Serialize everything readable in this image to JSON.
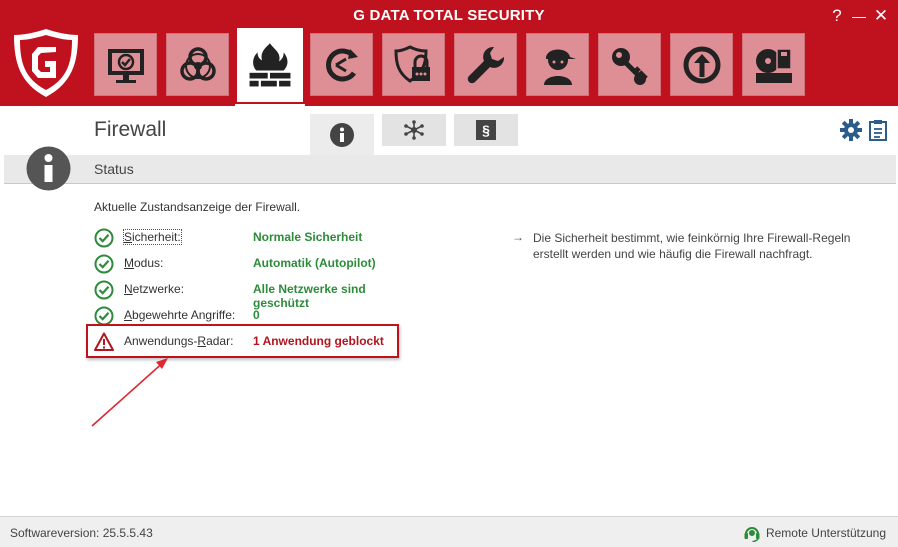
{
  "window": {
    "title": "G DATA TOTAL SECURITY",
    "help_glyph": "?",
    "minimize_glyph": "—",
    "close_glyph": "✕"
  },
  "modules": [
    {
      "name": "sicherheitscenter",
      "icon": "monitor-check-icon"
    },
    {
      "name": "virenschutz",
      "icon": "biohazard-icon"
    },
    {
      "name": "firewall",
      "icon": "firewall-icon",
      "active": true
    },
    {
      "name": "backup",
      "icon": "backup-icon"
    },
    {
      "name": "passwort-manager",
      "icon": "shield-lock-icon"
    },
    {
      "name": "tuner",
      "icon": "wrench-icon"
    },
    {
      "name": "kindersicherung",
      "icon": "child-icon"
    },
    {
      "name": "verschluesselung",
      "icon": "key-icon"
    },
    {
      "name": "autostart-manager",
      "icon": "power-up-icon"
    },
    {
      "name": "geraetekontrolle",
      "icon": "device-control-icon"
    }
  ],
  "page": {
    "title": "Firewall",
    "tabs": [
      {
        "name": "info",
        "icon": "info-icon"
      },
      {
        "name": "regelsaetze",
        "icon": "network-icon"
      },
      {
        "name": "einstellungen",
        "glyph": "§"
      }
    ],
    "toolbar_icons": [
      "gear-icon",
      "clipboard-icon"
    ]
  },
  "status": {
    "heading": "Status",
    "intro": "Aktuelle Zustandsanzeige der Firewall.",
    "rows": [
      {
        "label_mnemonic": "S",
        "label_rest": "icherheit:",
        "value": "Normale Sicherheit",
        "state": "ok"
      },
      {
        "label_mnemonic": "M",
        "label_rest": "odus:",
        "value": "Automatik (Autopilot)",
        "state": "ok"
      },
      {
        "label_mnemonic": "N",
        "label_rest": "etzwerke:",
        "value": "Alle Netzwerke sind geschützt",
        "state": "ok"
      },
      {
        "label_mnemonic": "A",
        "label_rest": "bgewehrte Angriffe:",
        "value": "0",
        "state": "ok"
      },
      {
        "label_pre": "Anwendungs-",
        "label_mnemonic": "R",
        "label_rest": "adar:",
        "value": "1 Anwendung geblockt",
        "state": "warning"
      }
    ],
    "help_arrow": "→",
    "help_text": "Die Sicherheit bestimmt, wie feinkörnig Ihre Firewall-Regeln erstellt werden und wie häufig die Firewall nachfragt."
  },
  "footer": {
    "version": "Softwareversion: 25.5.5.43",
    "remote": "Remote Unterstützung"
  },
  "colors": {
    "brand_red": "#c0111f",
    "module_tile": "#de8f96",
    "ok_green": "#2e8b3b",
    "warning_red": "#b01520"
  }
}
